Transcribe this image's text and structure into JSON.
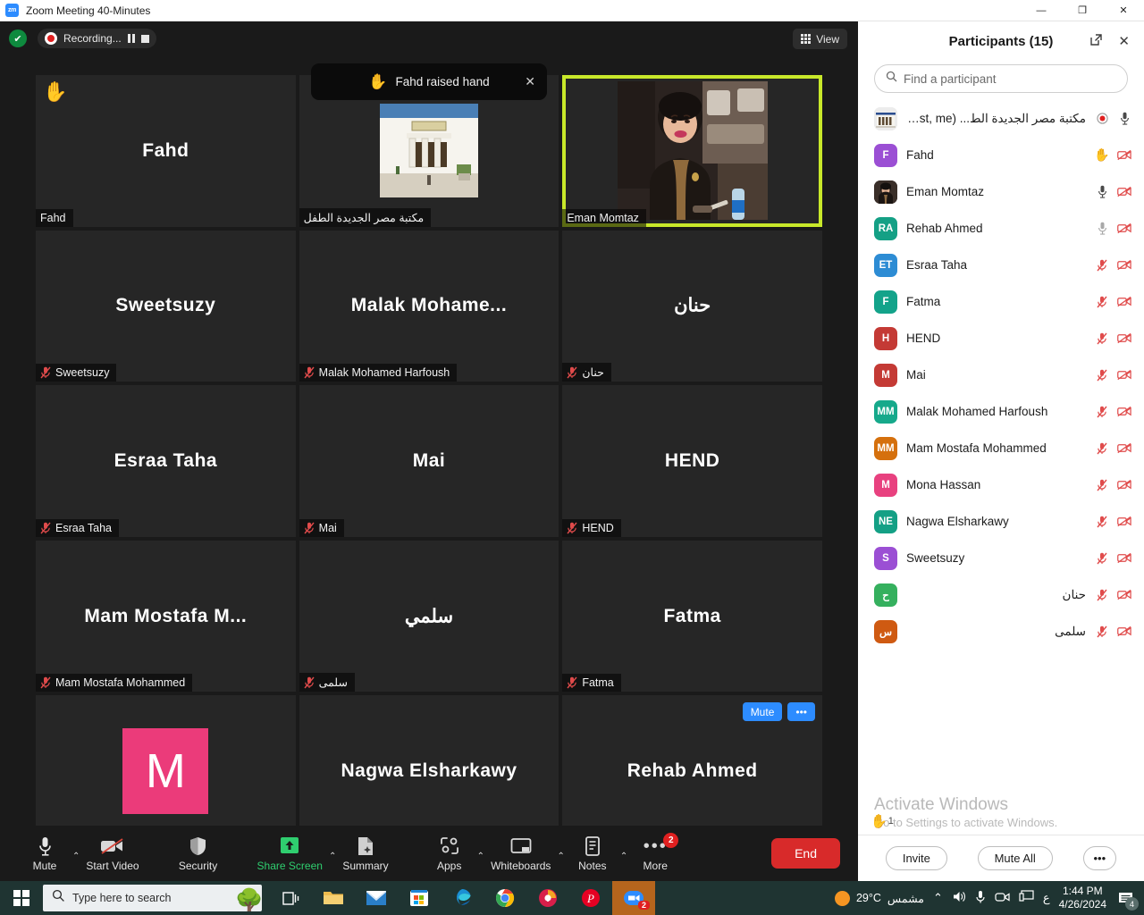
{
  "window": {
    "title": "Zoom Meeting 40-Minutes",
    "app_icon": "zoom-icon",
    "minimize": "—",
    "maximize": "❐",
    "close": "✕"
  },
  "topbar": {
    "shield_icon": "security-shield-icon",
    "shield_glyph": "✔",
    "recording_label": "Recording...",
    "pause_icon": "pause-recording-icon",
    "stop_icon": "stop-recording-icon",
    "view_label": "View",
    "view_icon": "grid-view-icon"
  },
  "toast": {
    "hand_icon": "raised-hand-icon",
    "hand_glyph": "✋",
    "message": "Fahd raised hand",
    "close_glyph": "✕"
  },
  "grid": {
    "tiles": [
      {
        "display_name": "Fahd",
        "label": "Fahd",
        "muted": false,
        "raised_hand": true,
        "kind": "name",
        "active": false
      },
      {
        "display_name": "مكتبة مصر الجديدة الطفل",
        "label": "مكتبة مصر الجديدة الطفل",
        "muted": false,
        "raised_hand": false,
        "kind": "photo-building",
        "active": false
      },
      {
        "display_name": "Eman Momtaz",
        "label": "Eman Momtaz",
        "muted": false,
        "raised_hand": false,
        "kind": "photo-person",
        "active": true
      },
      {
        "display_name": "Sweetsuzy",
        "label": "Sweetsuzy",
        "muted": true,
        "raised_hand": false,
        "kind": "name",
        "active": false
      },
      {
        "display_name": "Malak  Mohame...",
        "label": "Malak Mohamed Harfoush",
        "muted": true,
        "raised_hand": false,
        "kind": "name",
        "active": false
      },
      {
        "display_name": "حنان",
        "label": "حنان",
        "muted": true,
        "raised_hand": false,
        "kind": "name",
        "active": false
      },
      {
        "display_name": "Esraa Taha",
        "label": "Esraa Taha",
        "muted": true,
        "raised_hand": false,
        "kind": "name",
        "active": false
      },
      {
        "display_name": "Mai",
        "label": "Mai",
        "muted": true,
        "raised_hand": false,
        "kind": "name",
        "active": false
      },
      {
        "display_name": "HEND",
        "label": "HEND",
        "muted": true,
        "raised_hand": false,
        "kind": "name",
        "active": false
      },
      {
        "display_name": "Mam Mostafa M...",
        "label": "Mam Mostafa Mohammed",
        "muted": true,
        "raised_hand": false,
        "kind": "name",
        "active": false
      },
      {
        "display_name": "سلمي",
        "label": "سلمى",
        "muted": true,
        "raised_hand": false,
        "kind": "name",
        "active": false
      },
      {
        "display_name": "Fatma",
        "label": "Fatma",
        "muted": true,
        "raised_hand": false,
        "kind": "name",
        "active": false
      },
      {
        "display_name": "M",
        "label": "Mona Hassan",
        "muted": true,
        "raised_hand": false,
        "kind": "avatar",
        "avatar_letter": "M",
        "avatar_color": "#eb3b7a",
        "active": false
      },
      {
        "display_name": "Nagwa Elsharkawy",
        "label": "Nagwa Elsharkawy",
        "muted": true,
        "raised_hand": false,
        "kind": "name",
        "active": false
      },
      {
        "display_name": "Rehab Ahmed",
        "label": "Rehab Ahmed",
        "muted": false,
        "raised_hand": false,
        "kind": "name",
        "active": false,
        "hover_mute": "Mute",
        "hover_more": "•••"
      }
    ]
  },
  "toolbar": {
    "mute_label": "Mute",
    "mute_icon": "microphone-icon",
    "start_video_label": "Start Video",
    "start_video_icon": "video-off-icon",
    "security_label": "Security",
    "security_icon": "shield-icon",
    "share_screen_label": "Share Screen",
    "share_screen_icon": "share-screen-icon",
    "summary_label": "Summary",
    "summary_icon": "summary-sparkle-icon",
    "apps_label": "Apps",
    "apps_icon": "apps-icon",
    "whiteboards_label": "Whiteboards",
    "whiteboards_icon": "whiteboard-icon",
    "notes_label": "Notes",
    "notes_icon": "notes-icon",
    "more_label": "More",
    "more_icon": "more-dots-icon",
    "more_badge": "2",
    "end_label": "End",
    "caret_glyph": "⌃"
  },
  "participants": {
    "title": "Participants (15)",
    "popout_icon": "popout-icon",
    "close_icon": "close-icon",
    "search_placeholder": "Find a participant",
    "search_icon": "search-icon",
    "search_value": "",
    "host_row": {
      "name": "مكتبة مصر الجديدة الط...",
      "suffix": "(Host, me)",
      "avatar_kind": "library-building-photo",
      "recording_icon": "recording-dot-icon",
      "mic_icon": "microphone-on-icon"
    },
    "rows": [
      {
        "name": "Fahd",
        "initials": "F",
        "color": "#9b4fd4",
        "mic": "raised-hand",
        "video": "video-off"
      },
      {
        "name": "Eman Momtaz",
        "initials": "",
        "color": "#3a2a28",
        "avatar_kind": "photo",
        "mic": "mic-on-dark",
        "video": "video-off"
      },
      {
        "name": "Rehab Ahmed",
        "initials": "RA",
        "color": "#14a085",
        "mic": "mic-on-light",
        "video": "video-off"
      },
      {
        "name": "Esraa Taha",
        "initials": "ET",
        "color": "#2d8cd4",
        "mic": "mic-muted",
        "video": "video-off"
      },
      {
        "name": "Fatma",
        "initials": "F",
        "color": "#13a38a",
        "mic": "mic-muted",
        "video": "video-off"
      },
      {
        "name": "HEND",
        "initials": "H",
        "color": "#c43a35",
        "mic": "mic-muted",
        "video": "video-off"
      },
      {
        "name": "Mai",
        "initials": "M",
        "color": "#c43a35",
        "mic": "mic-muted",
        "video": "video-off"
      },
      {
        "name": "Malak Mohamed Harfoush",
        "initials": "MM",
        "color": "#16a98b",
        "mic": "mic-muted",
        "video": "video-off"
      },
      {
        "name": "Mam Mostafa Mohammed",
        "initials": "MM",
        "color": "#d5700d",
        "mic": "mic-muted",
        "video": "video-off"
      },
      {
        "name": "Mona Hassan",
        "initials": "M",
        "color": "#e8417f",
        "mic": "mic-muted",
        "video": "video-off"
      },
      {
        "name": "Nagwa Elsharkawy",
        "initials": "NE",
        "color": "#14a085",
        "mic": "mic-muted",
        "video": "video-off"
      },
      {
        "name": "Sweetsuzy",
        "initials": "S",
        "color": "#9b4fd4",
        "mic": "mic-muted",
        "video": "video-off"
      },
      {
        "name": "حنان",
        "initials": "ح",
        "color": "#35b05e",
        "mic": "mic-muted",
        "video": "video-off"
      },
      {
        "name": "سلمى",
        "initials": "س",
        "color": "#cf5a12",
        "mic": "mic-muted",
        "video": "video-off"
      }
    ],
    "hand_count": "1",
    "hand_icon": "raised-hand-icon",
    "footer": {
      "invite_label": "Invite",
      "mute_all_label": "Mute All",
      "more_label": "•••"
    }
  },
  "watermark": {
    "line1": "Activate Windows",
    "line2": "Go to Settings to activate Windows."
  },
  "taskbar": {
    "start_icon": "windows-start-icon",
    "search_placeholder": "Type here to search",
    "search_icon": "search-icon",
    "apps": [
      {
        "name": "task-view-icon"
      },
      {
        "name": "file-explorer-icon"
      },
      {
        "name": "mail-icon"
      },
      {
        "name": "microsoft-store-icon"
      },
      {
        "name": "edge-icon"
      },
      {
        "name": "chrome-icon"
      },
      {
        "name": "avast-icon"
      },
      {
        "name": "pinterest-icon"
      },
      {
        "name": "zoom-taskbar-icon",
        "badge": "2"
      }
    ],
    "weather_temp": "29°C",
    "weather_desc": "مشمس",
    "weather_icon": "sun-icon",
    "chevron": "⌃",
    "volume_icon": "volume-icon",
    "mic_icon": "microphone-icon",
    "camera_icon": "camera-icon",
    "display_icon": "display-icon",
    "lang": "ع",
    "time": "1:44 PM",
    "date": "4/26/2024",
    "notif_icon": "notifications-icon",
    "notif_count": "4"
  }
}
